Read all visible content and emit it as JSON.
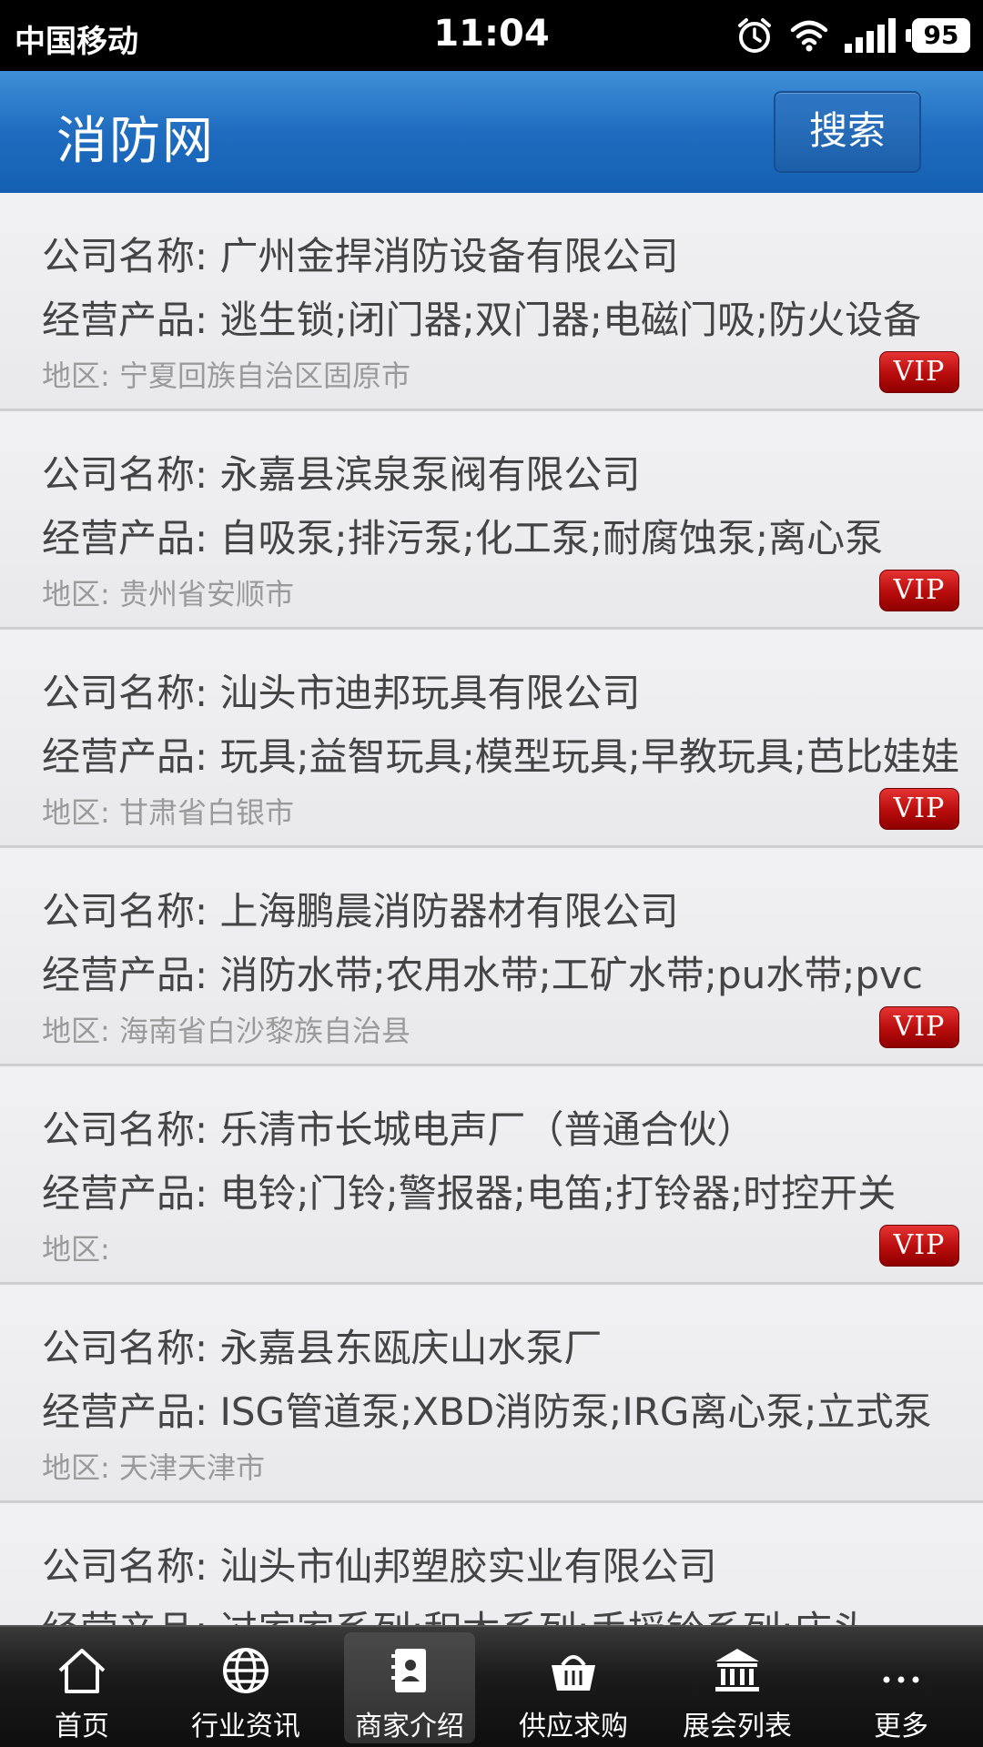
{
  "status_bar": {
    "carrier": "中国移动",
    "time": "11:04",
    "battery": "95",
    "icons": [
      "alarm-icon",
      "wifi-icon",
      "signal-icon",
      "battery-icon"
    ]
  },
  "header": {
    "title": "消防网",
    "search_label": "搜索"
  },
  "list": {
    "items": [
      {
        "name": "公司名称: 广州金捍消防设备有限公司",
        "products": "经营产品: 逃生锁;闭门器;双门器;电磁门吸;防火设备",
        "area": "地区: 宁夏回族自治区固原市",
        "badge": "VIP"
      },
      {
        "name": "公司名称: 永嘉县滨泉泵阀有限公司",
        "products": "经营产品: 自吸泵;排污泵;化工泵;耐腐蚀泵;离心泵",
        "area": "地区: 贵州省安顺市",
        "badge": "VIP"
      },
      {
        "name": "公司名称: 汕头市迪邦玩具有限公司",
        "products": "经营产品: 玩具;益智玩具;模型玩具;早教玩具;芭比娃娃",
        "area": "地区: 甘肃省白银市",
        "badge": "VIP"
      },
      {
        "name": "公司名称: 上海鹏晨消防器材有限公司",
        "products": "经营产品: 消防水带;农用水带;工矿水带;pu水带;pvc",
        "area": "地区: 海南省白沙黎族自治县",
        "badge": "VIP"
      },
      {
        "name": "公司名称: 乐清市长城电声厂（普通合伙）",
        "products": "经营产品: 电铃;门铃;警报器;电笛;打铃器;时控开关",
        "area": "地区:",
        "badge": "VIP"
      },
      {
        "name": "公司名称: 永嘉县东瓯庆山水泵厂",
        "products": "经营产品: ISG管道泵;XBD消防泵;IRG离心泵;立式泵",
        "area": "地区: 天津天津市",
        "badge": ""
      },
      {
        "name": "公司名称: 汕头市仙邦塑胶实业有限公司",
        "products": "经营产品: 过家家系列;积木系列;手摇铃系列;床头",
        "area": "",
        "badge": ""
      }
    ]
  },
  "tabbar": {
    "tabs": [
      {
        "label": "首页",
        "icon": "home-icon"
      },
      {
        "label": "行业资讯",
        "icon": "globe-icon"
      },
      {
        "label": "商家介绍",
        "icon": "contacts-book-icon",
        "active": true
      },
      {
        "label": "供应求购",
        "icon": "basket-icon"
      },
      {
        "label": "展会列表",
        "icon": "exhibition-hall-icon"
      },
      {
        "label": "更多",
        "icon": "more-icon"
      }
    ]
  }
}
